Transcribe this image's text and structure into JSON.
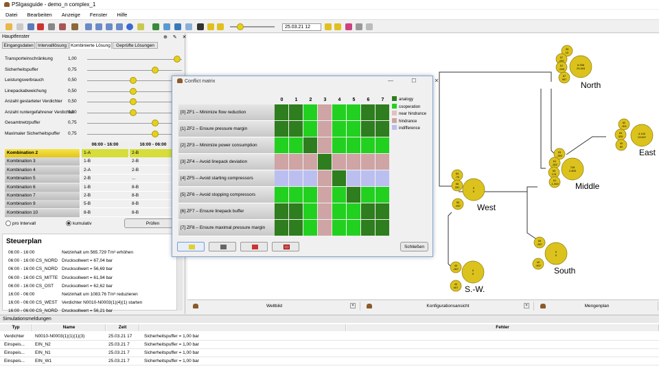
{
  "window": {
    "title": "PSIgasguide - demo_n complex_1"
  },
  "menu": [
    "Datei",
    "Bearbeiten",
    "Anzeige",
    "Fenster",
    "Hilfe"
  ],
  "toolbar": {
    "date": "25.03.21 12",
    "time_slider_percent": 15
  },
  "left_panel": {
    "title": "Hauptfenster",
    "header_icons": "⊕ ✎ ✕",
    "tabs": [
      {
        "label": "Eingangsdaten",
        "active": false
      },
      {
        "label": "Intervalllösung",
        "active": false
      },
      {
        "label": "Kombinierte Lösung",
        "active": true
      },
      {
        "label": "Geprüfte Lösungen",
        "active": false
      }
    ],
    "parameters": [
      {
        "label": "Transporteinschränkung",
        "value": "1,00",
        "slider": 1.0
      },
      {
        "label": "Sicherheitspuffer",
        "value": "0,75",
        "slider": 0.75
      },
      {
        "label": "Leistungsverbrauch",
        "value": "0,50",
        "slider": 0.5
      },
      {
        "label": "Linepackabweichung",
        "value": "0,50",
        "slider": 0.5
      },
      {
        "label": "Anzahl gestarteter Verdichter",
        "value": "0,50",
        "slider": 0.5
      },
      {
        "label": "Anzahl runtergefahrener Verdichter",
        "value": "0,50",
        "slider": 0.5
      },
      {
        "label": "Gesamtnetzpuffer",
        "value": "0,75",
        "slider": 0.75
      },
      {
        "label": "Maximaler Sicherheitspuffer",
        "value": "0,75",
        "slider": 0.75
      }
    ],
    "combo_headers": [
      "06:00 - 16:00",
      "16:00 - 06:00"
    ],
    "combinations": [
      {
        "name": "Kombination 2",
        "a": "1-A",
        "b": "2-B",
        "selected": true
      },
      {
        "name": "Kombination 3",
        "a": "1-B",
        "b": "2-B"
      },
      {
        "name": "Kombination 4",
        "a": "2-A",
        "b": "2-B"
      },
      {
        "name": "Kombination 5",
        "a": "2-B",
        "b": "..."
      },
      {
        "name": "Kombination 6",
        "a": "1-B",
        "b": "8-B"
      },
      {
        "name": "Kombination 7",
        "a": "2-B",
        "b": "8-B"
      },
      {
        "name": "Kombination 9",
        "a": "5-B",
        "b": "8-B"
      },
      {
        "name": "Kombination 10",
        "a": "8-B",
        "b": "8-B"
      }
    ],
    "radio_interval": "pro Intervall",
    "radio_cumulative": "kumulativ",
    "pruefen_label": "Prüfen",
    "steuerplan_title": "Steuerplan",
    "steuerplan": [
      {
        "time": "06:00 - 16:00",
        "msg": "Netzinhalt um 565.729 Tm³ erhöhen"
      },
      {
        "time": "06:00 - 16:00 CS_NORD",
        "msg": "Drucksollwert = 67,04 bar"
      },
      {
        "time": "06:00 - 16:00 CS_NORD",
        "msg": "Drucksollwert = 56,69 bar"
      },
      {
        "time": "06:00 - 16:00 CS_MITTE",
        "msg": "Drucksollwert = 61,94 bar"
      },
      {
        "time": "06:00 - 16:00 CS_OST",
        "msg": "Drucksollwert = 62,62 bar"
      },
      {
        "time": "16:00 - 06:00",
        "msg": "Netzinhalt um 1083.76 Tm³ reduzieren"
      },
      {
        "time": "16:00 - 06:00 CS_WEST",
        "msg": "Verdichter N0010-N0003(1)(4)(1) starten"
      },
      {
        "time": "16:00 - 06:00 CS_NORD",
        "msg": "Drucksollwert = 56,21 bar"
      }
    ]
  },
  "map": {
    "regions": [
      {
        "name": "North"
      },
      {
        "name": "East"
      },
      {
        "name": "Middle"
      },
      {
        "name": "West"
      },
      {
        "name": "South"
      },
      {
        "name": "S.-W."
      }
    ],
    "bubbles": [
      {
        "lines": [
          "39",
          "10"
        ]
      },
      {
        "lines": [
          "57",
          "-997"
        ]
      },
      {
        "lines": [
          "57",
          "-945"
        ]
      },
      {
        "lines": [
          "6.938",
          "23.463"
        ]
      },
      {
        "lines": [
          "67",
          "997"
        ]
      },
      {
        "lines": [
          "62",
          "-301"
        ]
      },
      {
        "lines": [
          "63",
          "325"
        ]
      },
      {
        "lines": [
          "40",
          "60"
        ]
      },
      {
        "lines": [
          "4.140",
          "13.847"
        ]
      },
      {
        "lines": [
          "53",
          "-360"
        ]
      },
      {
        "lines": [
          "61",
          "-302"
        ]
      },
      {
        "lines": [
          "53",
          "176"
        ]
      },
      {
        "lines": [
          "61",
          "-1.000"
        ]
      },
      {
        "lines": [
          "728",
          "2.805"
        ]
      },
      {
        "lines": [
          "54",
          "-76"
        ]
      },
      {
        "lines": [
          "56",
          "281"
        ]
      },
      {
        "lines": [
          "0",
          "0"
        ]
      },
      {
        "lines": [
          "55",
          "-457"
        ]
      },
      {
        "lines": [
          "59",
          "-907"
        ]
      },
      {
        "lines": [
          "40",
          "-907"
        ]
      },
      {
        "lines": [
          "0",
          "0"
        ]
      },
      {
        "lines": [
          "40",
          "-907"
        ]
      },
      {
        "lines": [
          "40",
          "907"
        ]
      },
      {
        "lines": [
          "0",
          "0"
        ]
      }
    ]
  },
  "bottom_tabs": [
    {
      "label": "Weltbild"
    },
    {
      "label": "Konfigurationsansicht"
    },
    {
      "label": "Mengenplan"
    }
  ],
  "sim": {
    "title": "Simulationsmeldungen",
    "columns": [
      "Typ",
      "Name",
      "Zeit",
      "",
      "Fehler"
    ],
    "rows": [
      {
        "typ": "Verdichter",
        "name": "N0010-N0003(1)(1)(1)(3)",
        "zeit": "25.03.21 17",
        "msg": "Sicherheitspuffer = 1,00 bar"
      },
      {
        "typ": "Einspeis...",
        "name": "EIN_N2",
        "zeit": "25.03.21 7",
        "msg": "Sicherheitspuffer = 1,00 bar"
      },
      {
        "typ": "Einspeis...",
        "name": "EIN_N1",
        "zeit": "25.03.21 7",
        "msg": "Sicherheitspuffer = 1,00 bar"
      },
      {
        "typ": "Einspeis...",
        "name": "EIN_W1",
        "zeit": "25.03.21 7",
        "msg": "Sicherheitspuffer = 1,00 bar"
      }
    ]
  },
  "dialog": {
    "title": "Conflict matrix",
    "controls": "— ☐ ✕",
    "columns": [
      "0",
      "1",
      "2",
      "3",
      "4",
      "5",
      "6",
      "7"
    ],
    "rows": [
      "[0] ZF1 – Minimize flow reduction",
      "[1] ZF2 – Ensure pressure margin",
      "[2] ZF3 – Minimize power consumption",
      "[3] ZF4 – Avoid linepack deviation",
      "[4] ZF5 – Avoid starting compressors",
      "[5] ZF6 – Avoid stopping compressors",
      "[6] ZF7 – Ensure linepack buffer",
      "[7] ZF8 – Ensure maximal pressure margin"
    ],
    "matrix": [
      [
        "A",
        "A",
        "C",
        "H",
        "C",
        "C",
        "A",
        "A"
      ],
      [
        "A",
        "A",
        "C",
        "H",
        "C",
        "C",
        "A",
        "A"
      ],
      [
        "C",
        "C",
        "A",
        "H",
        "C",
        "C",
        "C",
        "C"
      ],
      [
        "H",
        "H",
        "H",
        "A",
        "H",
        "H",
        "H",
        "H"
      ],
      [
        "I",
        "I",
        "I",
        "H",
        "A",
        "I",
        "I",
        "I"
      ],
      [
        "C",
        "C",
        "C",
        "H",
        "C",
        "A",
        "C",
        "C"
      ],
      [
        "A",
        "A",
        "C",
        "H",
        "C",
        "C",
        "A",
        "A"
      ],
      [
        "A",
        "A",
        "C",
        "H",
        "C",
        "C",
        "A",
        "A"
      ]
    ],
    "legend": [
      {
        "code": "A",
        "label": "analogy",
        "color": "#2e7d1e"
      },
      {
        "code": "C",
        "label": "cooperation",
        "color": "#22d11f"
      },
      {
        "code": "N",
        "label": "near hindrance",
        "color": "#e2bfbf"
      },
      {
        "code": "H",
        "label": "hindrance",
        "color": "#cfa4a4"
      },
      {
        "code": "I",
        "label": "indifference",
        "color": "#bbbfef"
      }
    ],
    "close_label": "Schließen"
  }
}
